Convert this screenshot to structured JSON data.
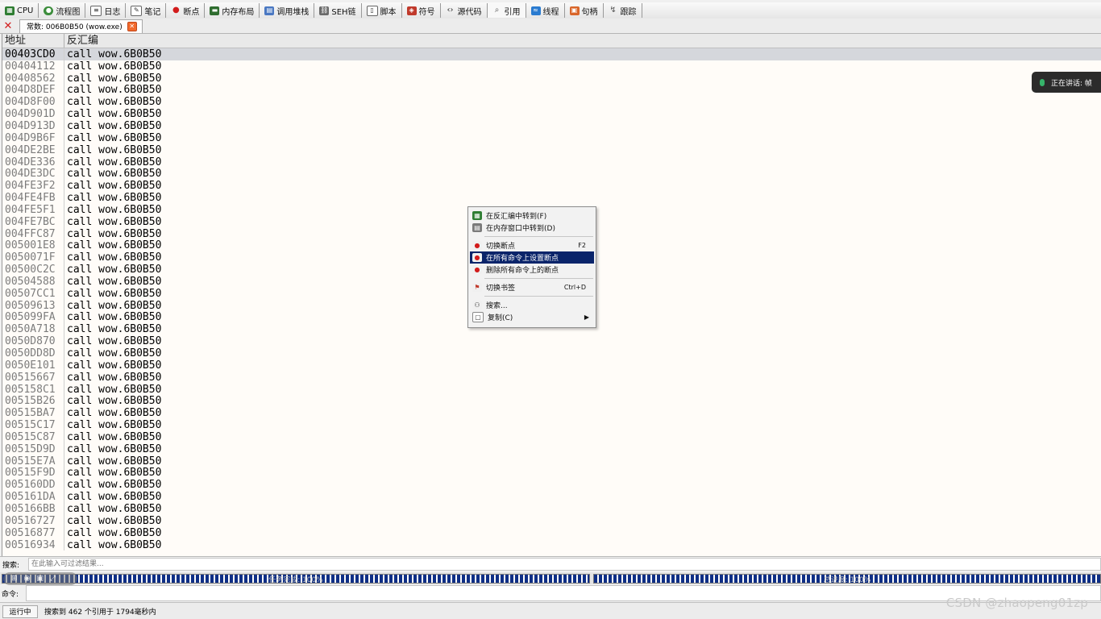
{
  "toolbar": {
    "tabs": [
      {
        "label": "CPU",
        "icon": "cpu-icon"
      },
      {
        "label": "流程图",
        "icon": "graph-icon"
      },
      {
        "label": "日志",
        "icon": "log-icon"
      },
      {
        "label": "笔记",
        "icon": "notes-icon"
      },
      {
        "label": "断点",
        "icon": "breakpoint-icon"
      },
      {
        "label": "内存布局",
        "icon": "memory-map-icon"
      },
      {
        "label": "调用堆栈",
        "icon": "call-stack-icon"
      },
      {
        "label": "SEH链",
        "icon": "seh-icon"
      },
      {
        "label": "脚本",
        "icon": "script-icon"
      },
      {
        "label": "符号",
        "icon": "symbols-icon"
      },
      {
        "label": "源代码",
        "icon": "source-icon"
      },
      {
        "label": "引用",
        "icon": "references-icon"
      },
      {
        "label": "线程",
        "icon": "threads-icon"
      },
      {
        "label": "句柄",
        "icon": "handles-icon"
      },
      {
        "label": "跟踪",
        "icon": "trace-icon"
      }
    ]
  },
  "reftab": {
    "label": "常数: 006B0B50 (wow.exe)"
  },
  "grid": {
    "col_address": "地址",
    "col_disasm": "反汇编",
    "rows": [
      {
        "addr": "00403CD0",
        "instr": "call wow.6B0B50"
      },
      {
        "addr": "00404112",
        "instr": "call wow.6B0B50"
      },
      {
        "addr": "00408562",
        "instr": "call wow.6B0B50"
      },
      {
        "addr": "004D8DEF",
        "instr": "call wow.6B0B50"
      },
      {
        "addr": "004D8F00",
        "instr": "call wow.6B0B50"
      },
      {
        "addr": "004D901D",
        "instr": "call wow.6B0B50"
      },
      {
        "addr": "004D913D",
        "instr": "call wow.6B0B50"
      },
      {
        "addr": "004D9B6F",
        "instr": "call wow.6B0B50"
      },
      {
        "addr": "004DE2BE",
        "instr": "call wow.6B0B50"
      },
      {
        "addr": "004DE336",
        "instr": "call wow.6B0B50"
      },
      {
        "addr": "004DE3DC",
        "instr": "call wow.6B0B50"
      },
      {
        "addr": "004FE3F2",
        "instr": "call wow.6B0B50"
      },
      {
        "addr": "004FE4FB",
        "instr": "call wow.6B0B50"
      },
      {
        "addr": "004FE5F1",
        "instr": "call wow.6B0B50"
      },
      {
        "addr": "004FE7BC",
        "instr": "call wow.6B0B50"
      },
      {
        "addr": "004FFC87",
        "instr": "call wow.6B0B50"
      },
      {
        "addr": "005001E8",
        "instr": "call wow.6B0B50"
      },
      {
        "addr": "0050071F",
        "instr": "call wow.6B0B50"
      },
      {
        "addr": "00500C2C",
        "instr": "call wow.6B0B50"
      },
      {
        "addr": "00504588",
        "instr": "call wow.6B0B50"
      },
      {
        "addr": "00507CC1",
        "instr": "call wow.6B0B50"
      },
      {
        "addr": "00509613",
        "instr": "call wow.6B0B50"
      },
      {
        "addr": "005099FA",
        "instr": "call wow.6B0B50"
      },
      {
        "addr": "0050A718",
        "instr": "call wow.6B0B50"
      },
      {
        "addr": "0050D870",
        "instr": "call wow.6B0B50"
      },
      {
        "addr": "0050DD8D",
        "instr": "call wow.6B0B50"
      },
      {
        "addr": "0050E101",
        "instr": "call wow.6B0B50"
      },
      {
        "addr": "00515667",
        "instr": "call wow.6B0B50"
      },
      {
        "addr": "005158C1",
        "instr": "call wow.6B0B50"
      },
      {
        "addr": "00515B26",
        "instr": "call wow.6B0B50"
      },
      {
        "addr": "00515BA7",
        "instr": "call wow.6B0B50"
      },
      {
        "addr": "00515C17",
        "instr": "call wow.6B0B50"
      },
      {
        "addr": "00515C87",
        "instr": "call wow.6B0B50"
      },
      {
        "addr": "00515D9D",
        "instr": "call wow.6B0B50"
      },
      {
        "addr": "00515E7A",
        "instr": "call wow.6B0B50"
      },
      {
        "addr": "00515F9D",
        "instr": "call wow.6B0B50"
      },
      {
        "addr": "005160DD",
        "instr": "call wow.6B0B50"
      },
      {
        "addr": "005161DA",
        "instr": "call wow.6B0B50"
      },
      {
        "addr": "005166BB",
        "instr": "call wow.6B0B50"
      },
      {
        "addr": "00516727",
        "instr": "call wow.6B0B50"
      },
      {
        "addr": "00516877",
        "instr": "call wow.6B0B50"
      },
      {
        "addr": "00516934",
        "instr": "call wow.6B0B50"
      }
    ]
  },
  "speaking": {
    "label": "正在讲话: 帧"
  },
  "context_menu": {
    "items": [
      {
        "label": "在反汇编中转到(F)",
        "icon": "disasm-goto-icon",
        "shortcut": ""
      },
      {
        "label": "在内存窗口中转到(D)",
        "icon": "memory-goto-icon",
        "shortcut": ""
      },
      {
        "label": "切换断点",
        "icon": "toggle-breakpoint-icon",
        "shortcut": "F2"
      },
      {
        "label": "在所有命令上设置断点",
        "icon": "set-breakpoints-icon",
        "shortcut": ""
      },
      {
        "label": "删除所有命令上的断点",
        "icon": "remove-breakpoints-icon",
        "shortcut": ""
      },
      {
        "label": "切换书签",
        "icon": "bookmark-icon",
        "shortcut": "Ctrl+D"
      },
      {
        "label": "搜索...",
        "icon": "binoculars-icon",
        "shortcut": ""
      },
      {
        "label": "复制(C)",
        "icon": "copy-icon",
        "shortcut": ""
      }
    ]
  },
  "search": {
    "label": "搜索:",
    "placeholder": "在此输入可过滤结果..."
  },
  "progress": {
    "left_label": "任务完成: 100%",
    "left_value": 1.0,
    "right_label": "总进度: 100%",
    "right_value": 1.0
  },
  "command": {
    "label": "命令:"
  },
  "status": {
    "state": "运行中",
    "message": "搜索到 462 个引用于 1794毫秒内"
  },
  "watermark": "CSDN @zhaopeng01zp",
  "colors": {
    "selection": "#0a246a",
    "progress_fill": "#0f2f86",
    "close_red": "#d21c1c"
  }
}
